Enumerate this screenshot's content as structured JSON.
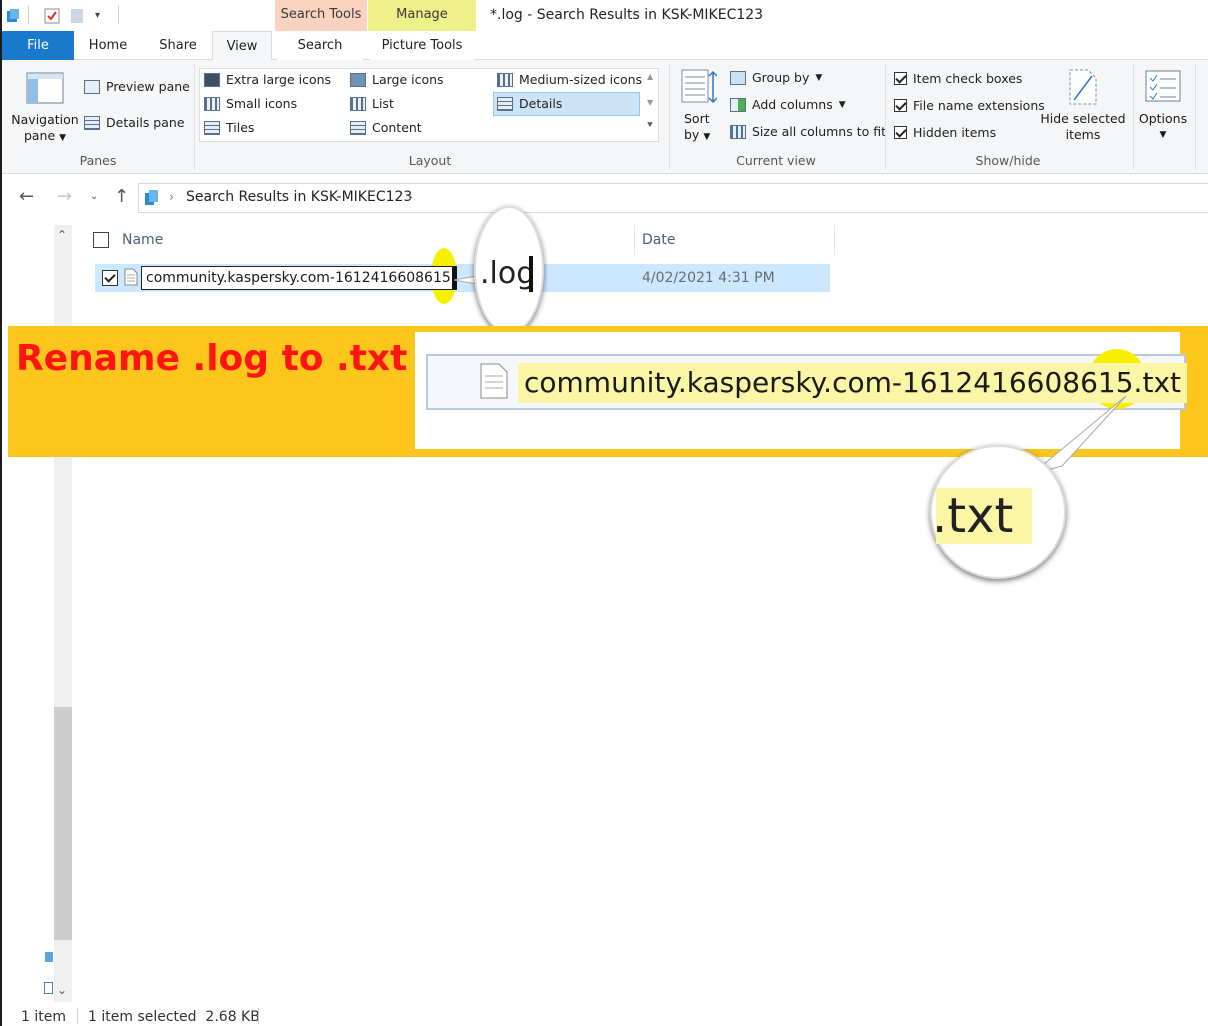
{
  "window": {
    "title": "*.log - Search Results in KSK-MIKEC123",
    "context_tabs": {
      "search_tools": "Search Tools",
      "manage": "Manage"
    }
  },
  "tabs": {
    "file": "File",
    "home": "Home",
    "share": "Share",
    "view": "View",
    "search": "Search",
    "picture_tools": "Picture Tools"
  },
  "ribbon": {
    "panes": {
      "label": "Panes",
      "navigation_pane": "Navigation",
      "navigation_pane2": "pane",
      "preview_pane": "Preview pane",
      "details_pane": "Details pane"
    },
    "layout": {
      "label": "Layout",
      "items": [
        "Extra large icons",
        "Large icons",
        "Medium-sized icons",
        "Small icons",
        "List",
        "Details",
        "Tiles",
        "Content"
      ]
    },
    "current_view": {
      "label": "Current view",
      "sort_by": "Sort",
      "sort_by2": "by",
      "group_by": "Group by",
      "add_columns": "Add columns",
      "size_all_columns": "Size all columns to fit"
    },
    "show_hide": {
      "label": "Show/hide",
      "item_check_boxes": "Item check boxes",
      "file_name_extensions": "File name extensions",
      "hidden_items": "Hidden items",
      "hide_selected": "Hide selected",
      "hide_selected2": "items"
    },
    "options": {
      "label": "Options"
    }
  },
  "address": {
    "path": "Search Results in KSK-MIKEC123"
  },
  "columns": {
    "name": "Name",
    "date": "Date"
  },
  "file": {
    "name_base": "community.kaspersky.com-1612416608615.",
    "name_ext": "log",
    "date": "4/02/2021 4:31 PM"
  },
  "callouts": {
    "log_zoom": ".log",
    "banner_text": "Rename .log to .txt",
    "renamed_base": "community.kaspersky.com-1612416608615.",
    "renamed_ext": "txt",
    "txt_zoom": ".txt"
  },
  "status": {
    "count": "1 item",
    "selection": "1 item selected  2.68 KB"
  },
  "colors": {
    "file_tab": "#1979ca",
    "search_tools": "#f9d3c0",
    "manage": "#eef08a",
    "banner": "#fcc61c",
    "banner_text": "#ff1414",
    "highlight": "#f7ef00"
  }
}
